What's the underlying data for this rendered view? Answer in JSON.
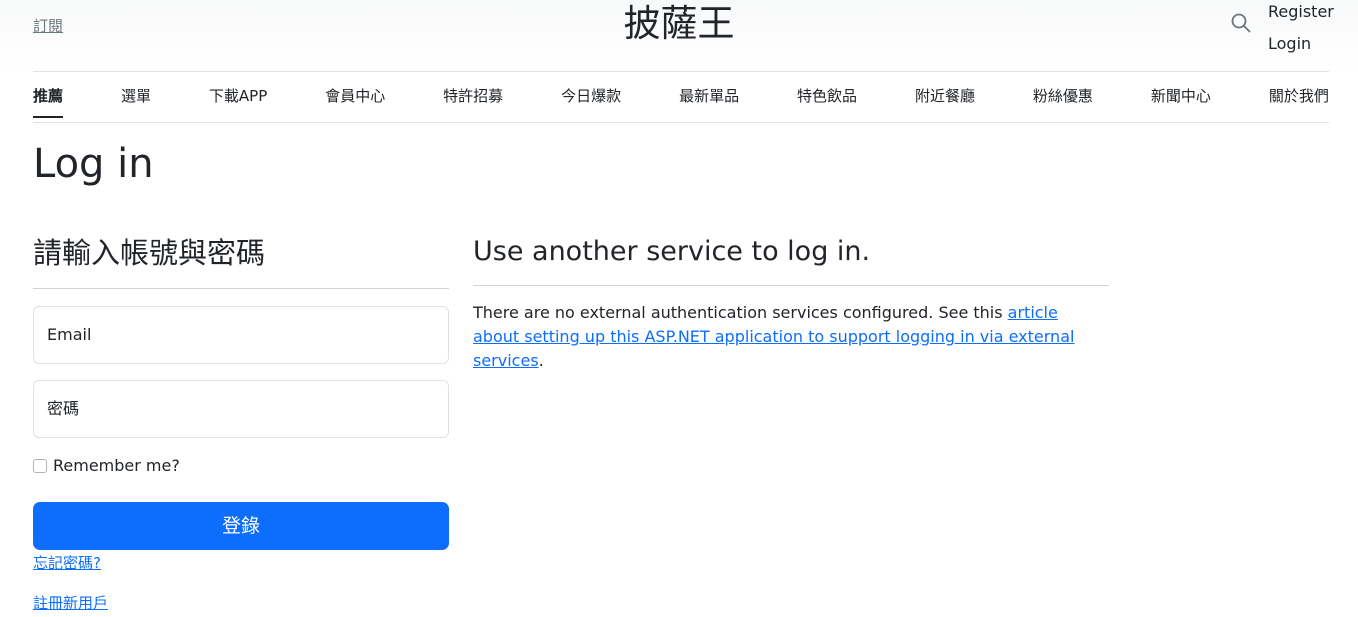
{
  "header": {
    "subscribe_label": "訂閱",
    "brand": "披薩王",
    "register_label": "Register",
    "login_label": "Login"
  },
  "nav": {
    "items": [
      "推薦",
      "選單",
      "下載APP",
      "會員中心",
      "特許招募",
      "今日爆款",
      "最新單品",
      "特色飲品",
      "附近餐廳",
      "粉絲優惠",
      "新聞中心",
      "關於我們"
    ],
    "active_index": 0
  },
  "page": {
    "title": "Log in"
  },
  "login_form": {
    "heading": "請輸入帳號與密碼",
    "email_placeholder": "Email",
    "password_placeholder": "密碼",
    "remember_label": "Remember me?",
    "remember_checked": false,
    "submit_label": "登錄",
    "forgot_link": "忘記密碼?",
    "register_link": "註冊新用戶"
  },
  "external": {
    "heading": "Use another service to log in.",
    "text_before": "There are no external authentication services configured. See this ",
    "link_text": "article about setting up this ASP.NET application to support logging in via external services",
    "text_after": "."
  },
  "colors": {
    "primary": "#0d6efd",
    "text": "#212529",
    "muted": "#6c757d",
    "border": "#dee2e6"
  }
}
